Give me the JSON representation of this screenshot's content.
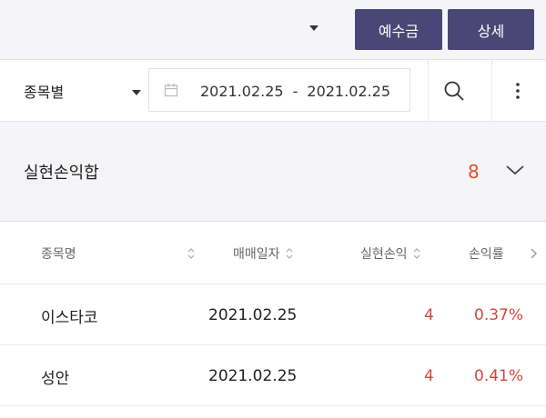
{
  "header": {
    "deposit_label": "예수금",
    "detail_label": "상세"
  },
  "filter": {
    "stock_select": "종목별",
    "date_from": "2021.02.25",
    "date_sep": "-",
    "date_to": "2021.02.25"
  },
  "summary": {
    "label": "실현손익합",
    "value": "8"
  },
  "table": {
    "columns": [
      "종목명",
      "매매일자",
      "실현손익",
      "손익률"
    ],
    "rows": [
      {
        "name": "이스타코",
        "date": "2021.02.25",
        "pnl": "4",
        "rate": "0.37%"
      },
      {
        "name": "성안",
        "date": "2021.02.25",
        "pnl": "4",
        "rate": "0.41%"
      }
    ]
  },
  "colors": {
    "accent": "#4a4777",
    "sum_value": "#e0502a",
    "profit": "#d2473e"
  },
  "icons": [
    "chevron-down-icon",
    "calendar-icon",
    "search-icon",
    "more-vertical-icon",
    "sort-icon",
    "chevron-right-icon"
  ]
}
